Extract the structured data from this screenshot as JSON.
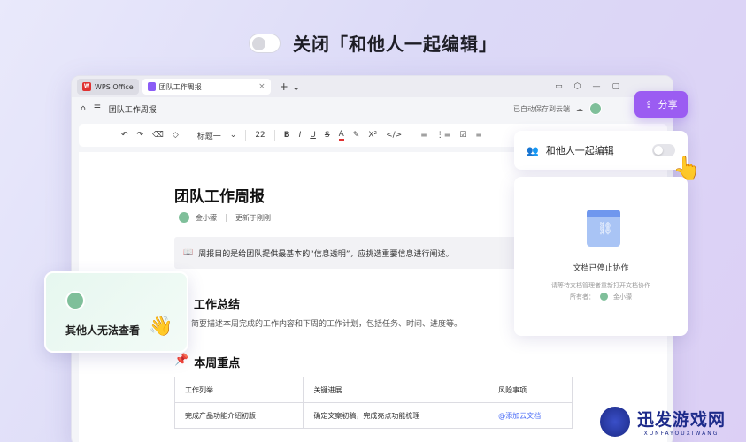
{
  "hero": {
    "title": "关闭「和他人一起编辑」"
  },
  "tabs": {
    "wps": "WPS Office",
    "doc": "团队工作周报",
    "close": "×",
    "plus": "+ ⌄"
  },
  "window_controls": [
    "▭",
    "⬡",
    "—",
    "▢"
  ],
  "address": {
    "doc_title": "团队工作周报",
    "save_status": "已自动保存到云端"
  },
  "toolbar": {
    "style": "标题一",
    "size": "22",
    "items": [
      "↶",
      "↷",
      "⌫",
      "◇",
      "B",
      "I",
      "U",
      "S",
      "A",
      "✎",
      "X²",
      "</>",
      "≡",
      "⋮≡",
      "☑",
      "≡"
    ]
  },
  "document": {
    "title": "团队工作周报",
    "author": "金小獴",
    "updated": "更新于刚刚",
    "quote_icon": "📖",
    "quote": "周报目的是给团队提供最基本的“信息透明”，应挑选重要信息进行阐述。",
    "section1_title": "工作总结",
    "section1_text": "简要描述本周完成的工作内容和下周的工作计划，包括任务、时间、进度等。",
    "section2_icon": "📌",
    "section2_title": "本周重点",
    "table": {
      "headers": [
        "工作列举",
        "关键进展",
        "风险事项"
      ],
      "rows": [
        [
          "完成产品功能介绍初版",
          "确定文案初稿，完成亮点功能梳理",
          "@添加云文档"
        ]
      ]
    }
  },
  "share": {
    "label": "分享"
  },
  "collab": {
    "label": "和他人一起编辑"
  },
  "stopped": {
    "title": "文档已停止协作",
    "desc": "请等待文档管理者重新打开文档协作",
    "owner_label": "所有者：",
    "owner": "金小獴"
  },
  "noview": {
    "text": "其他人无法查看"
  },
  "watermark": {
    "cn": "迅发游戏网",
    "en": "XUNFAYOUXIWANG"
  },
  "colors": {
    "accent": "#9b5cf2",
    "link": "#4a6cf7",
    "watermark": "#1d2b8a"
  }
}
